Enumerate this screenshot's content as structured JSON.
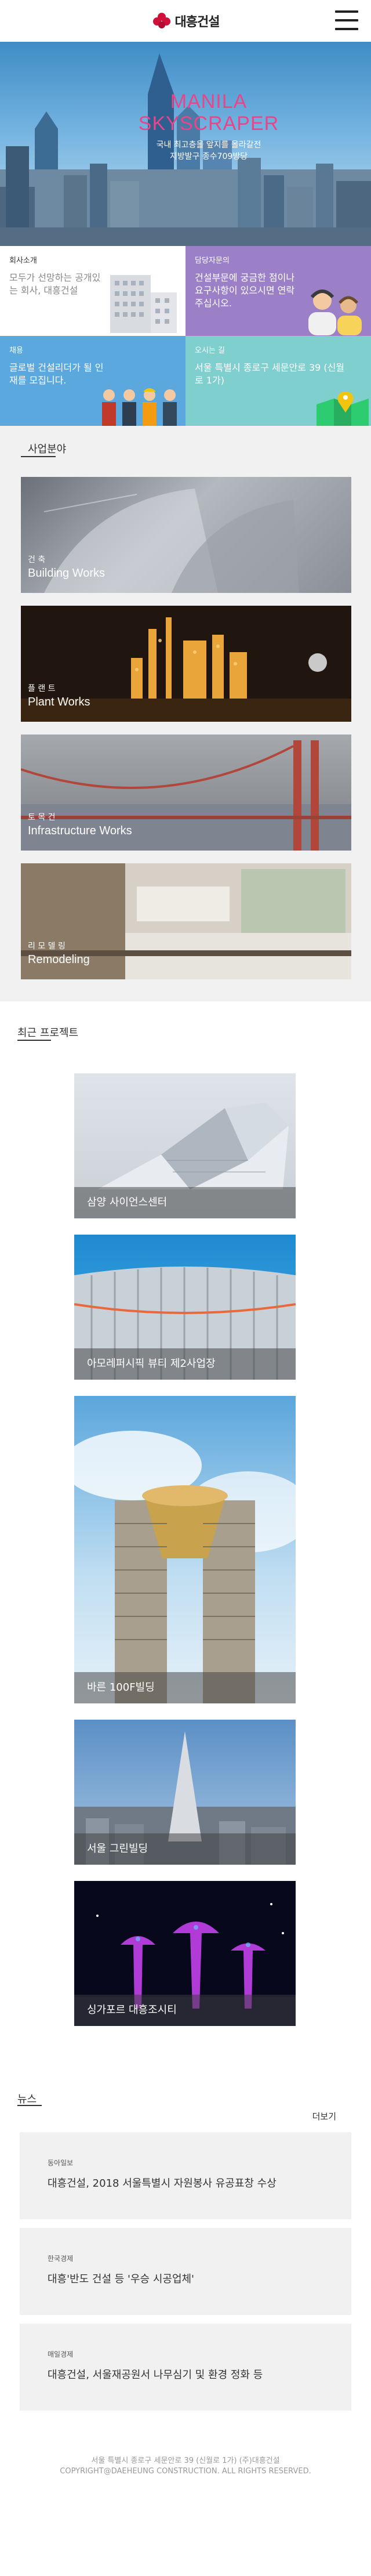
{
  "header": {
    "logo_text": "대흥건설",
    "logo_color": "#d0103a",
    "menu_icon": "hamburger-icon"
  },
  "hero": {
    "title_line1": "MANILA",
    "title_line2": "SKYSCRAPER",
    "subtitle_line1": "국내 최고층을 앞지를 올라갈전",
    "subtitle_line2": "지방발구 종수709방당",
    "title_color": "#e8458a"
  },
  "tiles": {
    "company": {
      "label": "회사소개",
      "text": "모두가 선망하는 공개있는 회사, 대흥건설"
    },
    "contact": {
      "label": "담당자문의",
      "text": "건설부문에 궁금한 점이나 요구사항이 있으시면 연락 주십시오."
    },
    "recruit": {
      "label": "채용",
      "text": "글로벌 건설리더가 될 인재를 모집니다."
    },
    "location": {
      "label": "오시는 길",
      "text": "서울 특별시 종로구 세문안로 39 (신월로 1가)"
    }
  },
  "business": {
    "title": "사업분야",
    "items": [
      {
        "sub": "건 축",
        "title": "Building Works"
      },
      {
        "sub": "플 랜 트",
        "title": "Plant Works"
      },
      {
        "sub": "토 목 건",
        "title": "Infrastructure Works"
      },
      {
        "sub": "리 모 델 링",
        "title": "Remodeling"
      }
    ]
  },
  "projects": {
    "title": "최근 프로젝트",
    "items": [
      {
        "label": "삼양 사이언스센터"
      },
      {
        "label": "아모레퍼시픽 뷰티 제2사업장"
      },
      {
        "label": "바른 100F빌딩"
      },
      {
        "label": "서울 그린빌딩"
      },
      {
        "label": "싱가포르 대흥조시티"
      }
    ]
  },
  "news": {
    "title": "뉴스",
    "more": "더보기",
    "items": [
      {
        "source": "동아일보",
        "title": "대흥건설, 2018 서울특별시 자원봉사 유공표창 수상"
      },
      {
        "source": "한국경제",
        "title": "대흥'반도 건설 등 '우승 시공업체'"
      },
      {
        "source": "매일경제",
        "title": "대흥건설, 서울재공원서 나무심기 및 환경 정화 등"
      }
    ]
  },
  "footer": {
    "address": "서울 특별시 종로구 세문안로 39 (신월로 1가) (주)대흥건설",
    "copyright": "COPYRIGHT@DAEHEUNG CONSTRUCTION. ALL RIGHTS RESERVED."
  }
}
